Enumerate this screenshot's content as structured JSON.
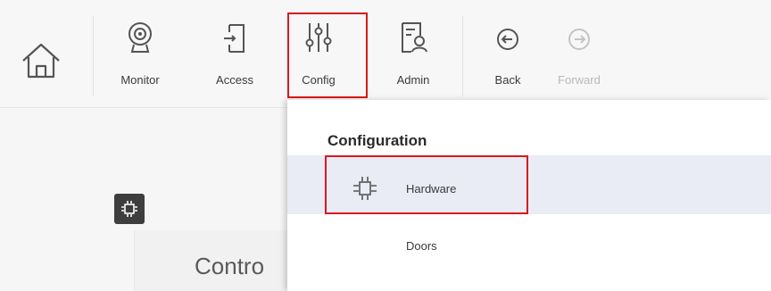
{
  "toolbar": {
    "home_icon": "home-icon",
    "buttons": [
      {
        "label": "Monitor",
        "icon": "webcam-icon"
      },
      {
        "label": "Access",
        "icon": "door-exit-icon"
      },
      {
        "label": "Config",
        "icon": "sliders-icon",
        "highlighted": true
      },
      {
        "label": "Admin",
        "icon": "admin-profile-icon"
      },
      {
        "label": "Back",
        "icon": "back-arrow-icon"
      },
      {
        "label": "Forward",
        "icon": "forward-arrow-icon",
        "disabled": true
      }
    ]
  },
  "menu": {
    "heading": "Configuration",
    "items": [
      {
        "label": "Hardware",
        "icon": "chip-icon",
        "selected": true,
        "highlighted": true
      },
      {
        "label": "Doors"
      }
    ]
  },
  "background": {
    "partial_label": "Contro",
    "tile_icon": "chip-icon"
  },
  "colors": {
    "highlight_border": "#d9191c",
    "selected_item_bg": "#e9ebf5",
    "toolbar_bg": "#f7f7f7"
  }
}
